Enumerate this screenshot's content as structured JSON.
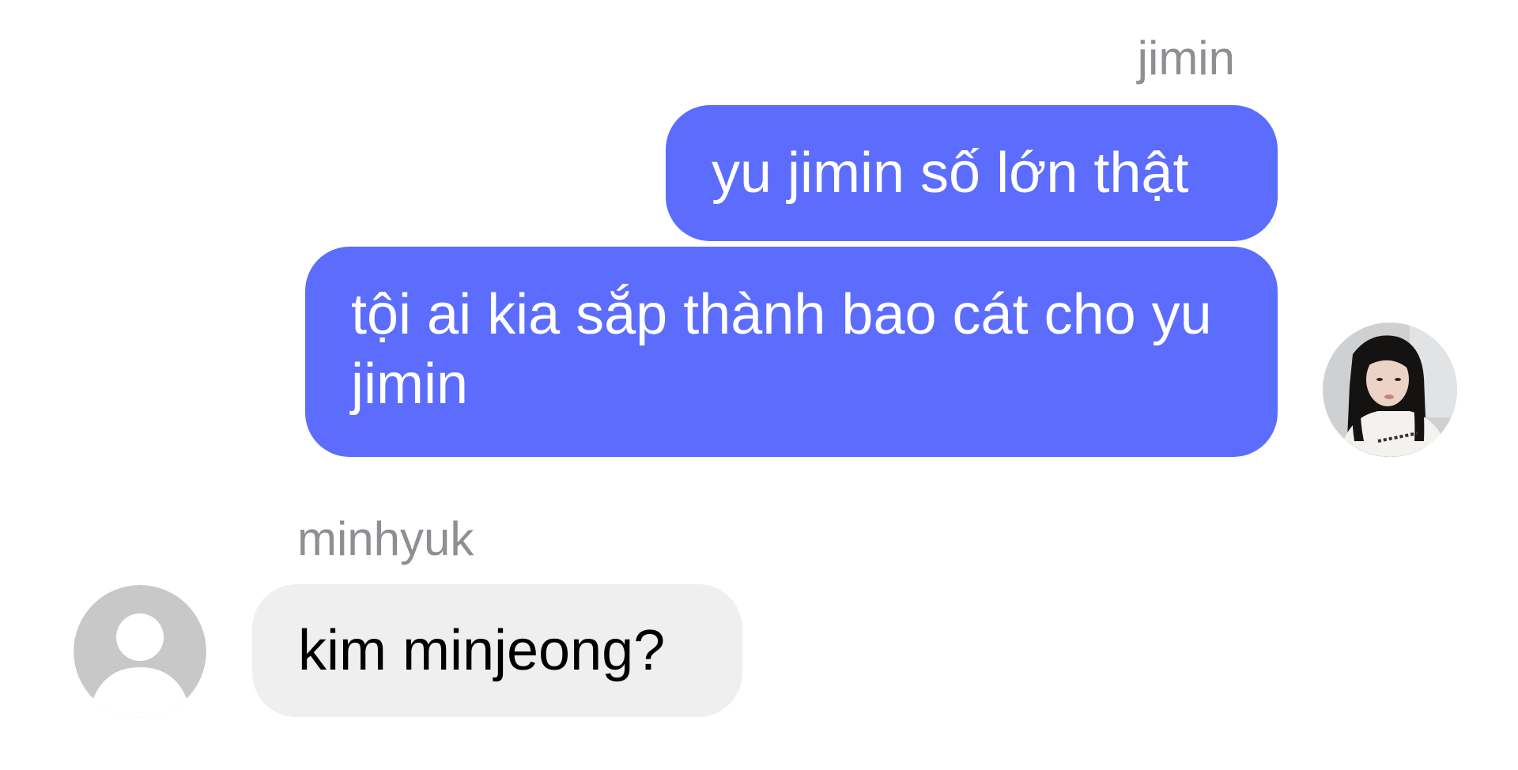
{
  "conversation": {
    "outgoing": {
      "sender": "jimin",
      "messages": [
        {
          "text": "yu jimin số lớn thật"
        },
        {
          "text": "tội ai kia sắp thành bao cát cho yu jimin"
        }
      ],
      "bubble_color": "#5c6dfd"
    },
    "incoming": {
      "sender": "minhyuk",
      "messages": [
        {
          "text": "kim minjeong?"
        }
      ],
      "bubble_color": "#efeff0"
    },
    "name_color": "#8e8e93"
  }
}
